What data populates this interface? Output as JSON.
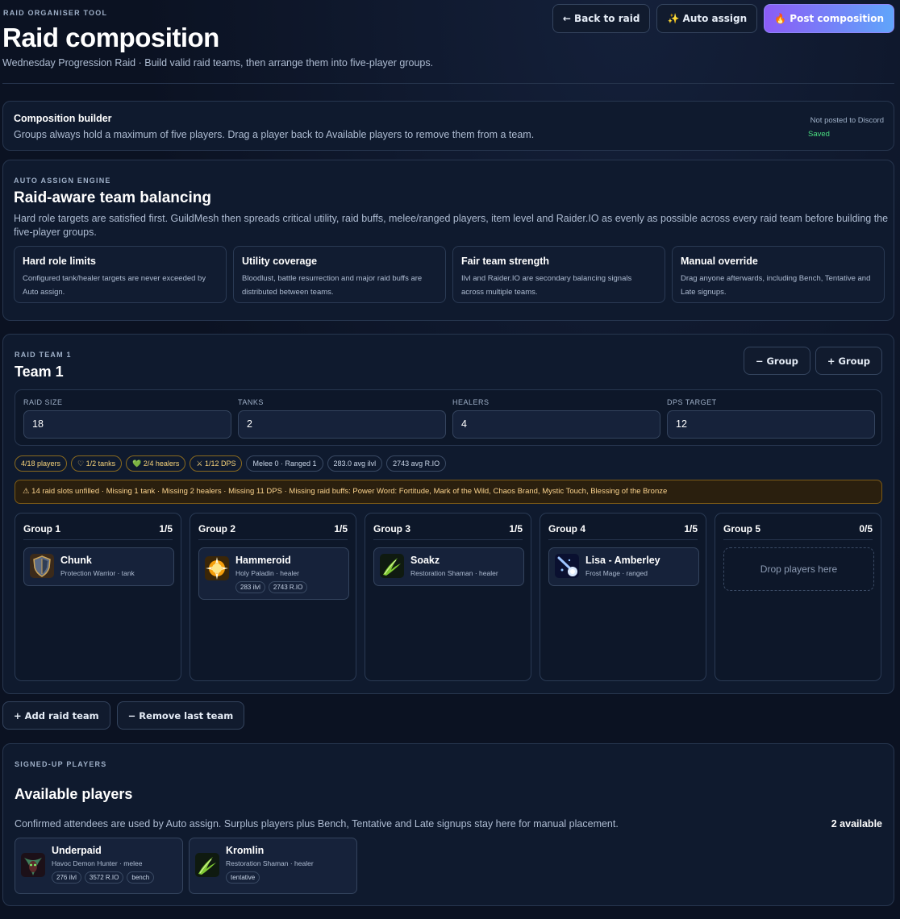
{
  "header": {
    "eyebrow": "RAID ORGANISER TOOL",
    "title": "Raid composition",
    "subtitle": "Wednesday Progression Raid · Build valid raid teams, then arrange them into five-player groups.",
    "back_label": "← Back to raid",
    "auto_label": "✨ Auto assign",
    "post_label": "🔥 Post composition"
  },
  "builder": {
    "title": "Composition builder",
    "description": "Groups always hold a maximum of five players. Drag a player back to Available players to remove them from a team.",
    "status": "Not posted to Discord",
    "saved": "Saved",
    "colors": {
      "saved": "#4ade80"
    }
  },
  "engine": {
    "eyebrow": "AUTO ASSIGN ENGINE",
    "title": "Raid-aware team balancing",
    "description": "Hard role targets are satisfied first. GuildMesh then spreads critical utility, raid buffs, melee/ranged players, item level and Raider.IO as evenly as possible across every raid team before building the five-player groups.",
    "features": [
      {
        "title": "Hard role limits",
        "text": "Configured tank/healer targets are never exceeded by Auto assign."
      },
      {
        "title": "Utility coverage",
        "text": "Bloodlust, battle resurrection and major raid buffs are distributed between teams."
      },
      {
        "title": "Fair team strength",
        "text": "Ilvl and Raider.IO are secondary balancing signals across multiple teams."
      },
      {
        "title": "Manual override",
        "text": "Drag anyone afterwards, including Bench, Tentative and Late signups."
      }
    ]
  },
  "team": {
    "eyebrow": "RAID TEAM 1",
    "title": "Team 1",
    "minus_group": "− Group",
    "plus_group": "+ Group",
    "config": [
      {
        "label": "RAID SIZE",
        "value": "18"
      },
      {
        "label": "TANKS",
        "value": "2"
      },
      {
        "label": "HEALERS",
        "value": "4"
      },
      {
        "label": "DPS TARGET",
        "value": "12"
      }
    ],
    "chips": [
      "4/18 players",
      "♡ 1/2 tanks",
      "💚 2/4 healers",
      "⚔ 1/12 DPS",
      "Melee 0 · Ranged 1",
      "283.0 avg ilvl",
      "2743 avg R.IO"
    ],
    "alert": "⚠ 14 raid slots unfilled · Missing 1 tank · Missing 2 healers · Missing 11 DPS · Missing raid buffs: Power Word: Fortitude, Mark of the Wild, Chaos Brand, Mystic Touch, Blessing of the Bronze",
    "groups": [
      {
        "name": "Group 1",
        "count": "1/5",
        "player": {
          "name": "Chunk",
          "spec": "Protection Warrior · tank",
          "icon": "shield-icon",
          "tags": []
        }
      },
      {
        "name": "Group 2",
        "count": "1/5",
        "player": {
          "name": "Hammeroid",
          "spec": "Holy Paladin · healer",
          "icon": "holy-light-icon",
          "tags": [
            "283 ilvl",
            "2743 R.IO"
          ]
        }
      },
      {
        "name": "Group 3",
        "count": "1/5",
        "player": {
          "name": "Soakz",
          "spec": "Restoration Shaman · healer",
          "icon": "restoration-icon",
          "tags": []
        }
      },
      {
        "name": "Group 4",
        "count": "1/5",
        "player": {
          "name": "Lisa - Amberley",
          "spec": "Frost Mage · ranged",
          "icon": "frost-icon",
          "tags": []
        }
      },
      {
        "name": "Group 5",
        "count": "0/5",
        "drop": "Drop players here"
      }
    ]
  },
  "team_actions": {
    "add": "+ Add raid team",
    "remove": "− Remove last team"
  },
  "available": {
    "eyebrow": "SIGNED-UP PLAYERS",
    "title": "Available players",
    "description": "Confirmed attendees are used by Auto assign. Surplus players plus Bench, Tentative and Late signups stay here for manual placement.",
    "count": "2 available",
    "players": [
      {
        "name": "Underpaid",
        "spec": "Havoc Demon Hunter · melee",
        "icon": "demon-hunter-icon",
        "tags": [
          "276 ilvl",
          "3572 R.IO",
          "bench"
        ]
      },
      {
        "name": "Kromlin",
        "spec": "Restoration Shaman · healer",
        "icon": "restoration-icon",
        "tags": [
          "tentative"
        ]
      }
    ]
  }
}
